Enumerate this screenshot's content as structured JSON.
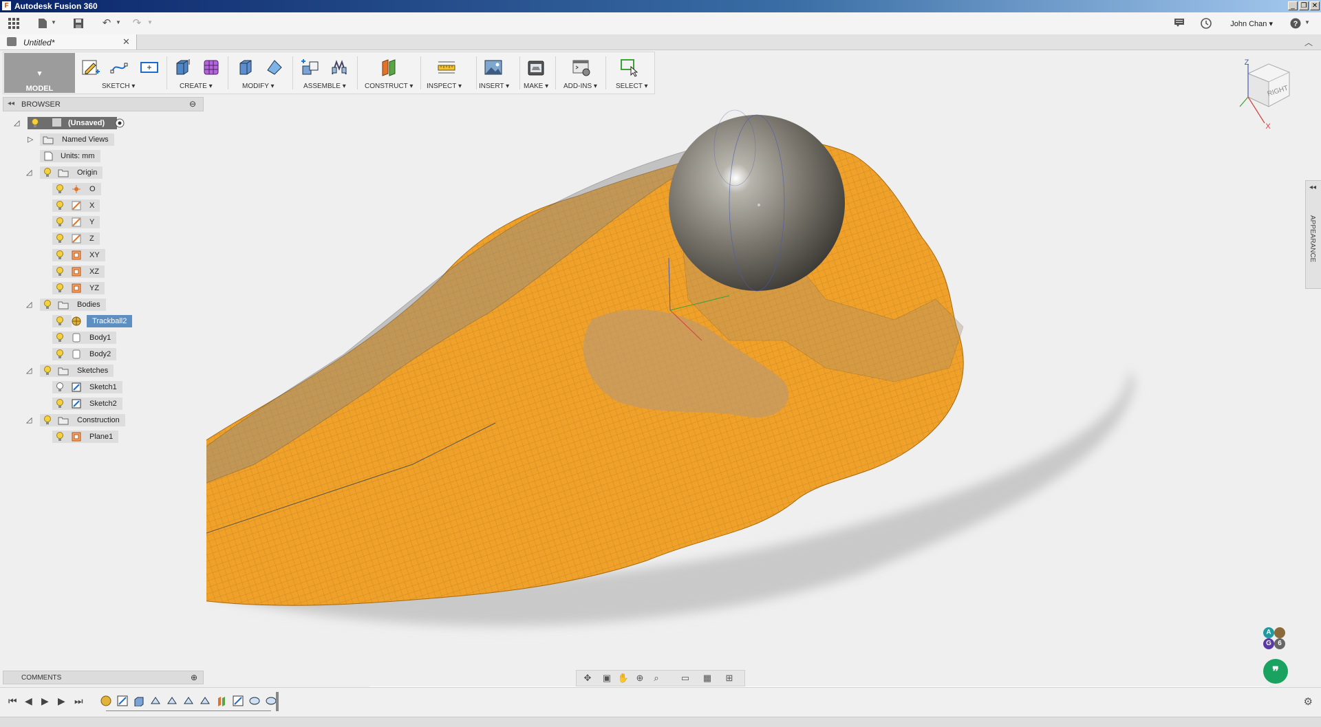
{
  "window": {
    "title": "Autodesk Fusion 360"
  },
  "user": {
    "name": "John Chan"
  },
  "document": {
    "tab_title": "Untitled*"
  },
  "ribbon": {
    "workspace": "MODEL",
    "groups": [
      "SKETCH",
      "CREATE",
      "MODIFY",
      "ASSEMBLE",
      "CONSTRUCT",
      "INSPECT",
      "INSERT",
      "MAKE",
      "ADD-INS",
      "SELECT"
    ]
  },
  "browser": {
    "header": "BROWSER",
    "root": "(Unsaved)",
    "named_views": "Named Views",
    "units": "Units: mm",
    "origin": {
      "label": "Origin",
      "items": [
        "O",
        "X",
        "Y",
        "Z",
        "XY",
        "XZ",
        "YZ"
      ]
    },
    "bodies": {
      "label": "Bodies",
      "items": [
        "Trackball2",
        "Body1",
        "Body2"
      ]
    },
    "sketches": {
      "label": "Sketches",
      "items": [
        "Sketch1",
        "Sketch2"
      ]
    },
    "construction": {
      "label": "Construction",
      "items": [
        "Plane1"
      ]
    }
  },
  "viewcube": {
    "face_label": "RIGHT",
    "axis_z": "Z",
    "axis_x": "X"
  },
  "side_panel": {
    "label": "APPEARANCE"
  },
  "comments": {
    "label": "COMMENTS"
  },
  "collaborators": [
    "A",
    "G",
    "6"
  ],
  "colors": {
    "surface_orange": "#f0a12a",
    "selection_blue": "#5e8fc2",
    "chat_green": "#1aa260"
  }
}
